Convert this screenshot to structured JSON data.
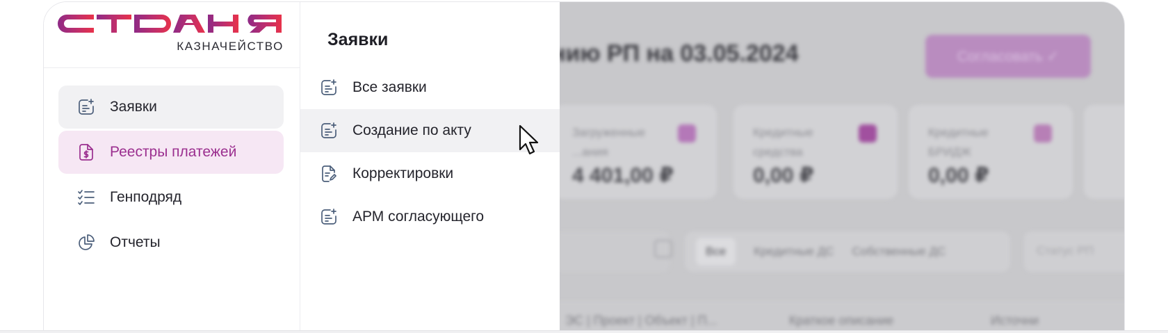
{
  "brand": {
    "logo_text": "СТРАНА",
    "subtitle": "КАЗНАЧЕЙСТВО",
    "colors": {
      "primary": "#8e2a86",
      "accent": "#e8324a"
    }
  },
  "sidebar": {
    "items": [
      {
        "label": "Заявки",
        "icon": "request-add-icon",
        "state": "hover"
      },
      {
        "label": "Реестры платежей",
        "icon": "dollar-document-icon",
        "state": "active"
      },
      {
        "label": "Генподряд",
        "icon": "checklist-icon",
        "state": "default"
      },
      {
        "label": "Отчеты",
        "icon": "pie-chart-icon",
        "state": "default"
      }
    ]
  },
  "submenu": {
    "title": "Заявки",
    "items": [
      {
        "label": "Все заявки",
        "icon": "request-add-icon"
      },
      {
        "label": "Создание по акту",
        "icon": "request-add-icon",
        "state": "hover"
      },
      {
        "label": "Корректировки",
        "icon": "document-edit-icon"
      },
      {
        "label": "АРМ согласующего",
        "icon": "request-add-icon"
      }
    ]
  },
  "main": {
    "title": "нию РП на 03.05.2024",
    "approve_button": "Согласовать ✓",
    "cards": [
      {
        "label": "Загруженные ...ания",
        "value": "4 401,00 ₽",
        "icon_color": "#b478b8"
      },
      {
        "label": "Кредитные средства",
        "value": "0,00 ₽",
        "icon_color": "#a1509f"
      },
      {
        "label": "Кредитные БРИДЖ",
        "value": "0,00 ₽",
        "icon_color": "#b77fb6"
      }
    ],
    "filters": [
      "Все",
      "Кредитные ДС",
      "Собственные ДС"
    ],
    "status_placeholder": "Статус РП",
    "columns": [
      "ЭС | Проект | Объект | П...",
      "Краткое описание",
      "Источни"
    ]
  }
}
